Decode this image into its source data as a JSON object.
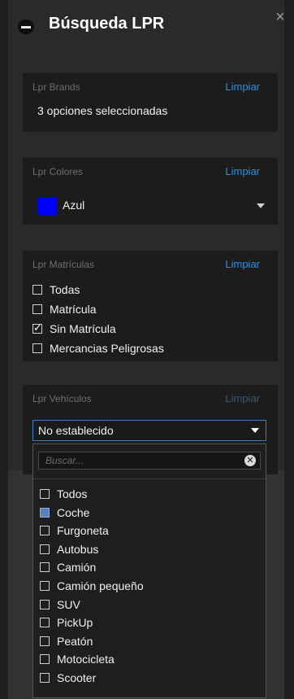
{
  "title": "Búsqueda LPR",
  "brands": {
    "label": "Lpr Brands",
    "clear": "Limpiar",
    "value": "3 opciones seleccionadas"
  },
  "colors": {
    "label": "Lpr Colores",
    "clear": "Limpiar",
    "value": "Azul",
    "swatch_color": "#0000ff"
  },
  "plates": {
    "label": "Lpr Matrículas",
    "clear": "Limpiar",
    "options": [
      {
        "label": "Todas",
        "checked": false
      },
      {
        "label": "Matrícula",
        "checked": false
      },
      {
        "label": "Sin Matrícula",
        "checked": true
      },
      {
        "label": "Mercancias Peligrosas",
        "checked": false
      }
    ]
  },
  "vehicles": {
    "label": "Lpr Vehículos",
    "clear": "Limpiar",
    "selected": "No establecido",
    "search_placeholder": "Buscar...",
    "options": [
      {
        "label": "Todos",
        "state": "unchecked"
      },
      {
        "label": "Coche",
        "state": "partial"
      },
      {
        "label": "Furgoneta",
        "state": "unchecked"
      },
      {
        "label": "Autobus",
        "state": "unchecked"
      },
      {
        "label": "Camión",
        "state": "unchecked"
      },
      {
        "label": "Camión pequeño",
        "state": "unchecked"
      },
      {
        "label": "SUV",
        "state": "unchecked"
      },
      {
        "label": "PickUp",
        "state": "unchecked"
      },
      {
        "label": "Peatón",
        "state": "unchecked"
      },
      {
        "label": "Motocicleta",
        "state": "unchecked"
      },
      {
        "label": "Scooter",
        "state": "unchecked"
      }
    ]
  }
}
